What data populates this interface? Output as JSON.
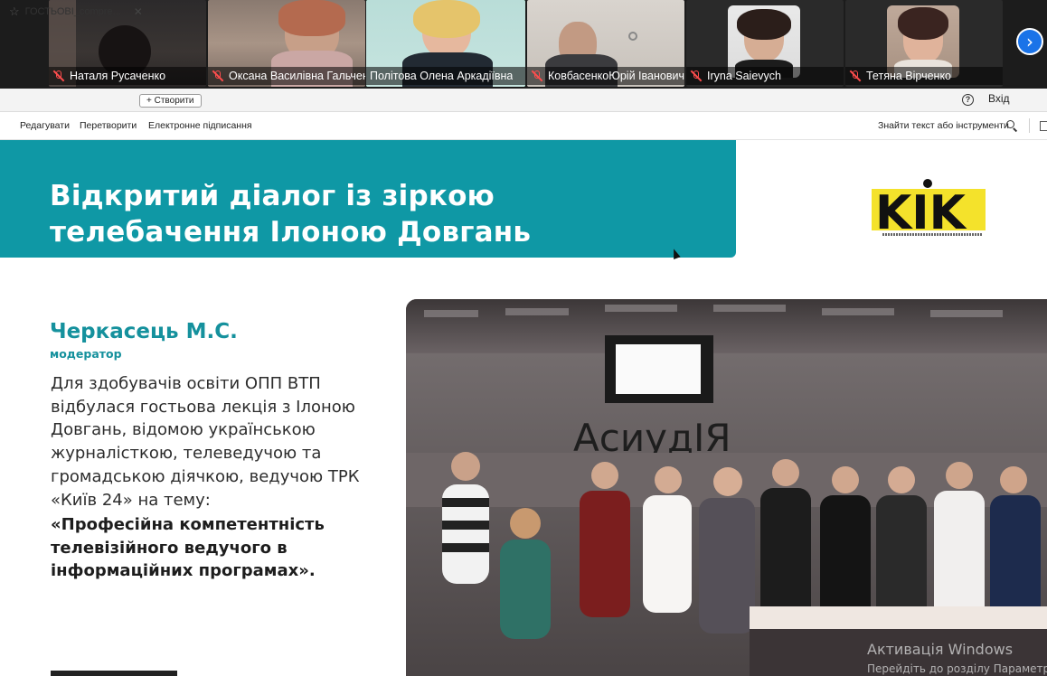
{
  "meeting": {
    "participants": [
      {
        "name": "Наталя Русаченко",
        "muted": true,
        "active": false
      },
      {
        "name": "Оксана Василівна Гальченко",
        "muted": true,
        "active": false
      },
      {
        "name": "Політова Олена Аркадіївна",
        "muted": false,
        "active": true
      },
      {
        "name": "КовбасенкоЮрій Іванович",
        "muted": true,
        "active": false
      },
      {
        "name": "Iryna Saievych",
        "muted": true,
        "active": false
      },
      {
        "name": "Тетяна Вірченко",
        "muted": true,
        "active": false
      }
    ],
    "next_icon": "chevron-right-icon"
  },
  "browser": {
    "tab_title": "ГОСТЬОВІ_compre...",
    "create_label": "Створити",
    "help_icon": "?",
    "signin_label": "Вхід"
  },
  "toolbar": {
    "menu": [
      "Редагувати",
      "Перетворити",
      "Електронне підписання"
    ],
    "find_label": "Знайти текст або інструменти"
  },
  "document": {
    "banner_title_line1": "Відкритий діалог із зіркою",
    "banner_title_line2": "телебачення Ілоною Довгань",
    "logo_text": "KIK",
    "author": "Черкасець М.С.",
    "role": "модератор",
    "body": "Для здобувачів освіти ОПП ВТП відбулася гостьова лекція з Ілоною Довгань, відомою українською журналісткою, телеведучою та громадською діячкою, ведучою ТРК «Київ 24» на тему:",
    "topic": "«Професійна компетентність телевізійного ведучого в інформаційних програмах».",
    "photo_sign_text": "АсиудІЯ"
  },
  "overlay": {
    "activate_title": "Активація Windows",
    "activate_sub": "Перейдіть до розділу Параметри"
  },
  "colors": {
    "banner": "#0f98a5",
    "accent_text": "#15919d",
    "active_speaker": "#3fd17a",
    "next_button": "#1a73e8",
    "muted_icon": "#ff4d4d"
  }
}
